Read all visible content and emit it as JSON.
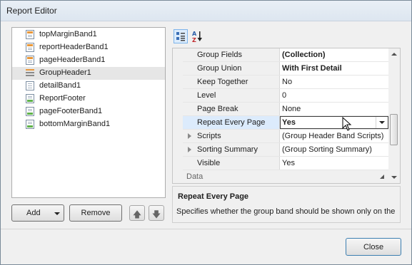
{
  "window": {
    "title": "Report Editor"
  },
  "bands": [
    {
      "label": "topMarginBand1",
      "icon": "top-margin-band-icon",
      "color": "#e8973a"
    },
    {
      "label": "reportHeaderBand1",
      "icon": "report-header-band-icon",
      "color": "#e8973a"
    },
    {
      "label": "pageHeaderBand1",
      "icon": "page-header-band-icon",
      "color": "#e8973a"
    },
    {
      "label": "GroupHeader1",
      "icon": "group-header-band-icon",
      "color": "#e8973a",
      "selected": true
    },
    {
      "label": "detailBand1",
      "icon": "detail-band-icon",
      "color": "#7d8fa3"
    },
    {
      "label": "ReportFooter",
      "icon": "report-footer-band-icon",
      "color": "#5fb24a"
    },
    {
      "label": "pageFooterBand1",
      "icon": "page-footer-band-icon",
      "color": "#5fb24a"
    },
    {
      "label": "bottomMarginBand1",
      "icon": "bottom-margin-band-icon",
      "color": "#5fb24a"
    }
  ],
  "buttons": {
    "add": "Add",
    "remove": "Remove",
    "move_up": "🡅",
    "move_down": "🡇",
    "close": "Close"
  },
  "toolbar": {
    "categorized_icon": "categorized-view-icon",
    "alphabetical_icon": "alphabetical-sort-icon"
  },
  "properties": [
    {
      "name": "Group Fields",
      "value": "(Collection)",
      "bold": true
    },
    {
      "name": "Group Union",
      "value": "With First Detail",
      "bold": true
    },
    {
      "name": "Keep Together",
      "value": "No"
    },
    {
      "name": "Level",
      "value": "0"
    },
    {
      "name": "Page Break",
      "value": "None"
    },
    {
      "name": "Repeat Every Page",
      "value": "Yes",
      "selected": true,
      "editor": "dropdown"
    },
    {
      "name": "Scripts",
      "value": "(Group Header Band Scripts)",
      "expandable": true
    },
    {
      "name": "Sorting Summary",
      "value": "(Group Sorting Summary)",
      "expandable": true
    },
    {
      "name": "Visible",
      "value": "Yes"
    }
  ],
  "category": "Data",
  "description": {
    "title": "Repeat Every Page",
    "text": "Specifies whether the group band should be shown only on the"
  },
  "colors": {
    "top_bands": "#e8973a",
    "detail_band": "#7d8fa3",
    "bottom_bands": "#5fb24a",
    "selection": "#dcebfc"
  }
}
